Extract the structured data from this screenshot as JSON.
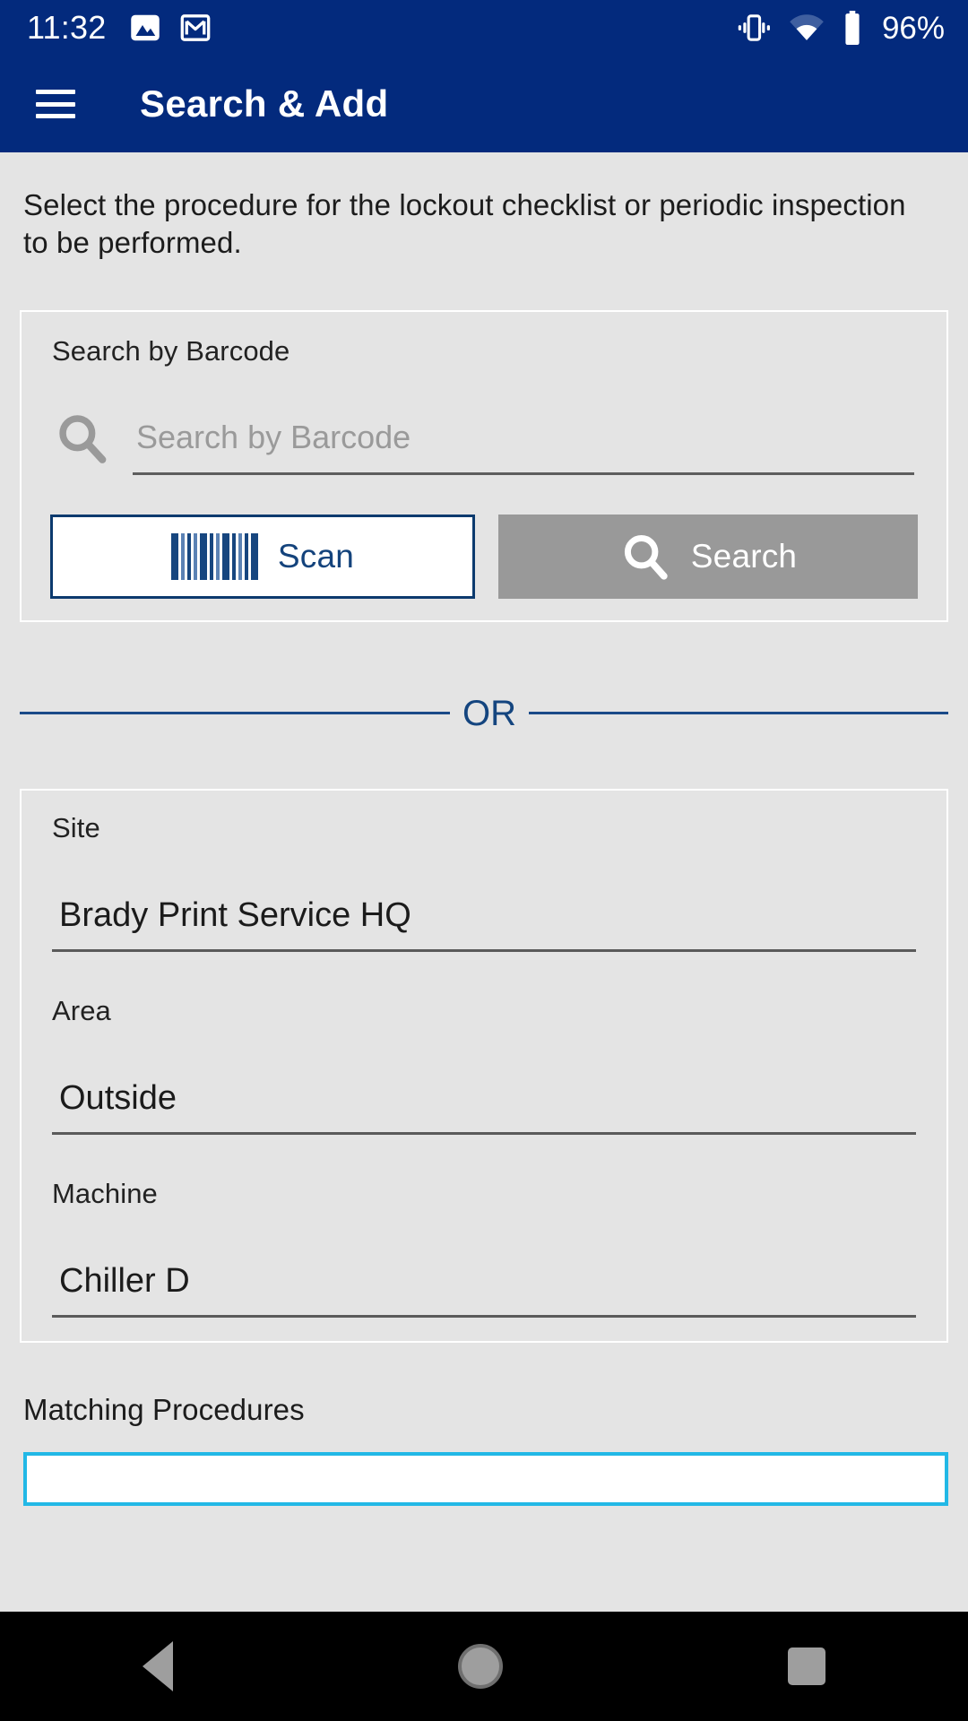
{
  "status_bar": {
    "time": "11:32",
    "battery_percent": "96%",
    "icons": [
      "photo-icon",
      "gmail-icon",
      "vibrate-icon",
      "wifi-icon",
      "battery-icon"
    ]
  },
  "app_bar": {
    "menu_icon": "hamburger-menu-icon",
    "title": "Search & Add"
  },
  "instruction": "Select the procedure for the lockout checklist or periodic inspection to be performed.",
  "barcode_card": {
    "label": "Search by Barcode",
    "search_icon": "search-icon",
    "input_value": "",
    "input_placeholder": "Search by Barcode",
    "scan_button": {
      "label": "Scan",
      "icon": "barcode-icon",
      "enabled": true
    },
    "search_button": {
      "label": "Search",
      "icon": "search-icon",
      "enabled": false
    }
  },
  "divider": {
    "text": "OR"
  },
  "location_card": {
    "fields": [
      {
        "label": "Site",
        "value": "Brady Print Service HQ"
      },
      {
        "label": "Area",
        "value": "Outside"
      },
      {
        "label": "Machine",
        "value": "Chiller D"
      }
    ]
  },
  "matching": {
    "label": "Matching Procedures"
  },
  "nav_bar": {
    "back": "back-triangle-icon",
    "home": "home-circle-icon",
    "recents": "recents-square-icon"
  },
  "colors": {
    "primary_navy": "#032a7d",
    "accent_blue": "#14457f",
    "disabled_gray": "#999999",
    "page_background": "#e4e4e4",
    "highlight_cyan": "#22b8e6"
  }
}
